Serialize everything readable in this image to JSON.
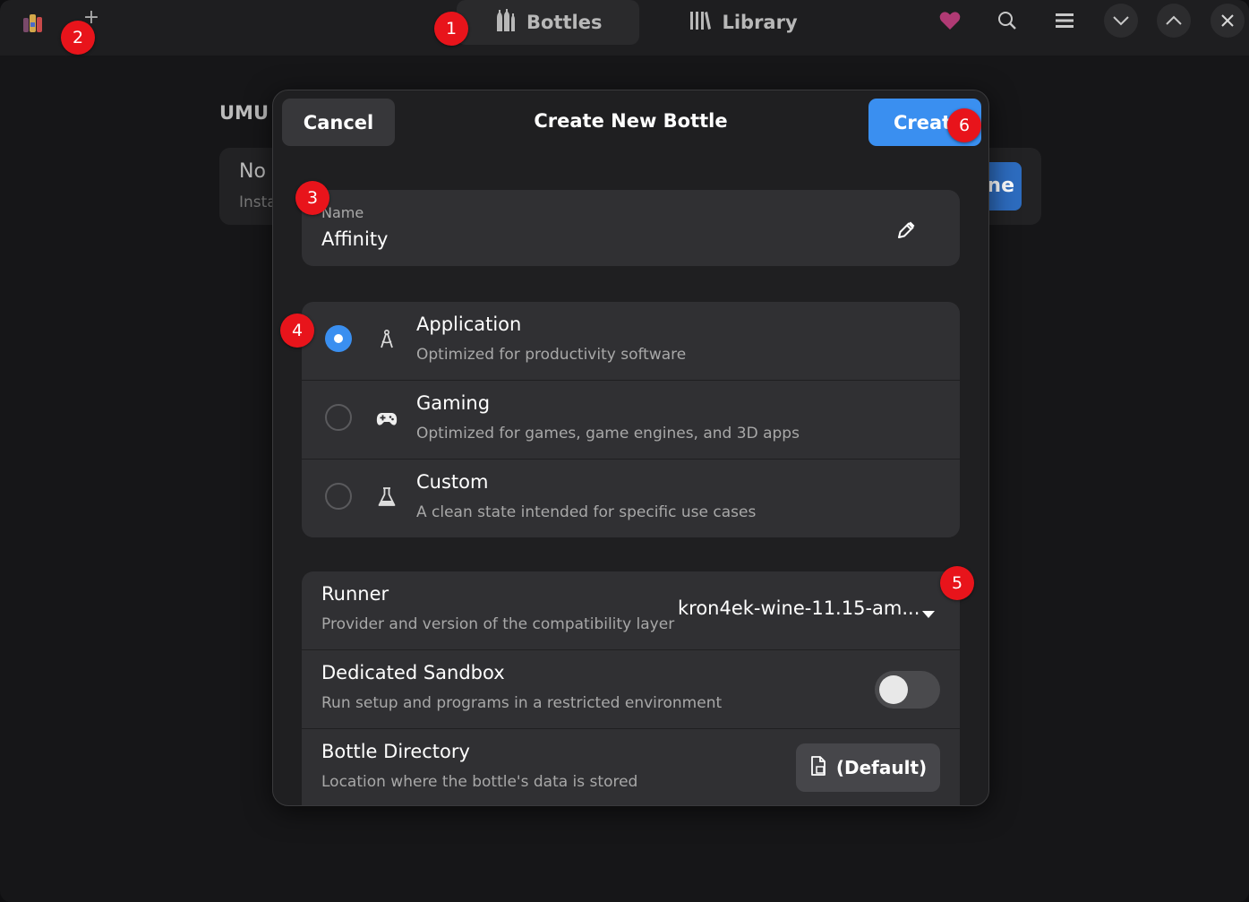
{
  "headerbar": {
    "tabs": [
      {
        "label": "Bottles",
        "icon": "bottles-icon",
        "active": true
      },
      {
        "label": "Library",
        "icon": "library-icon",
        "active": false
      }
    ],
    "icons": [
      "app-icon",
      "add-icon",
      "heart-icon",
      "search-icon",
      "menu-icon",
      "minimize-icon",
      "maximize-icon",
      "close-icon"
    ]
  },
  "background": {
    "heading": "UMU",
    "card_title": "No",
    "card_subtitle": "Insta",
    "card_button": "ne"
  },
  "dialog": {
    "cancel_label": "Cancel",
    "title": "Create New Bottle",
    "create_label": "Create",
    "name": {
      "label": "Name",
      "value": "Affinity"
    },
    "environments": [
      {
        "title": "Application",
        "subtitle": "Optimized for productivity software",
        "icon": "compass-icon",
        "selected": true
      },
      {
        "title": "Gaming",
        "subtitle": "Optimized for games, game engines, and 3D apps",
        "icon": "gamepad-icon",
        "selected": false
      },
      {
        "title": "Custom",
        "subtitle": "A clean state intended for specific use cases",
        "icon": "flask-icon",
        "selected": false
      }
    ],
    "runner": {
      "title": "Runner",
      "subtitle": "Provider and version of the compatibility layer",
      "value": "kron4ek-wine-11.15-am..."
    },
    "sandbox": {
      "title": "Dedicated Sandbox",
      "subtitle": "Run setup and programs in a restricted environment",
      "enabled": false
    },
    "directory": {
      "title": "Bottle Directory",
      "subtitle": "Location where the bottle's data is stored",
      "button_label": "(Default)"
    }
  },
  "badges": [
    "1",
    "2",
    "3",
    "4",
    "5",
    "6"
  ],
  "colors": {
    "accent": "#3a8ff0",
    "badge": "#e8141b",
    "heart": "#b03a74"
  }
}
